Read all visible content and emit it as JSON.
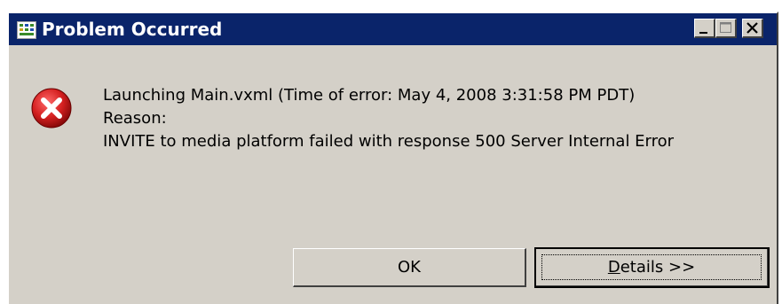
{
  "window": {
    "title": "Problem Occurred",
    "controls": {
      "minimize": "minimize-icon",
      "maximize": "maximize-icon",
      "close": "close-icon"
    }
  },
  "message": {
    "icon": "error-icon",
    "line1": "Launching Main.vxml (Time of error: May 4, 2008 3:31:58 PM PDT)",
    "line2": "Reason:",
    "line3": "INVITE to media platform failed with response 500 Server Internal Error"
  },
  "buttons": {
    "ok": "OK",
    "details_mnemonic": "D",
    "details_rest": "etails >>"
  },
  "colors": {
    "titlebar": "#0a246a",
    "dialog_bg": "#d4d0c8",
    "error_red": "#d42020"
  }
}
